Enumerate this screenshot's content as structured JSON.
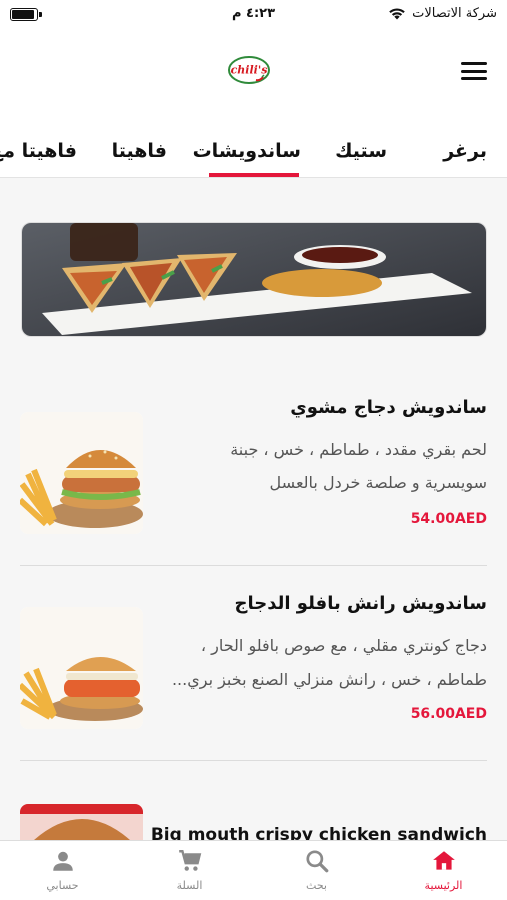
{
  "status_bar": {
    "carrier": "شركة الاتصالات",
    "time": "٤:٢٣ م",
    "battery_level": 0.9
  },
  "header": {
    "logo_text": "chili's"
  },
  "tabs": [
    {
      "label": "برغر"
    },
    {
      "label": "ستيك"
    },
    {
      "label": "ساندويشات",
      "active": true
    },
    {
      "label": "فاهيتا"
    },
    {
      "label": "فاهيتا مع"
    }
  ],
  "items": [
    {
      "title": "ساندويش دجاج مشوي",
      "desc_line1": "لحم بقري مقدد ، طماطم ، خس ، جبنة",
      "desc_line2": "سويسرية و صلصة خردل بالعسل",
      "price": "54.00AED"
    },
    {
      "title": "ساندويش رانش بافلو الدجاج",
      "desc_line1": "دجاج كونتري مقلي ، مع صوص بافلو الحار ،",
      "desc_line2": "طماطم ، خس ، رانش منزلي الصنع بخبز بري...",
      "price": "56.00AED"
    },
    {
      "title": "Big mouth crispy chicken sandwich"
    }
  ],
  "bottom_nav": [
    {
      "label": "الرئيسية",
      "icon": "home-icon",
      "active": true
    },
    {
      "label": "بحث",
      "icon": "search-icon"
    },
    {
      "label": "السلة",
      "icon": "cart-icon"
    },
    {
      "label": "حسابي",
      "icon": "account-icon"
    }
  ],
  "colors": {
    "accent": "#e4173b",
    "background": "#f6f6f6"
  }
}
